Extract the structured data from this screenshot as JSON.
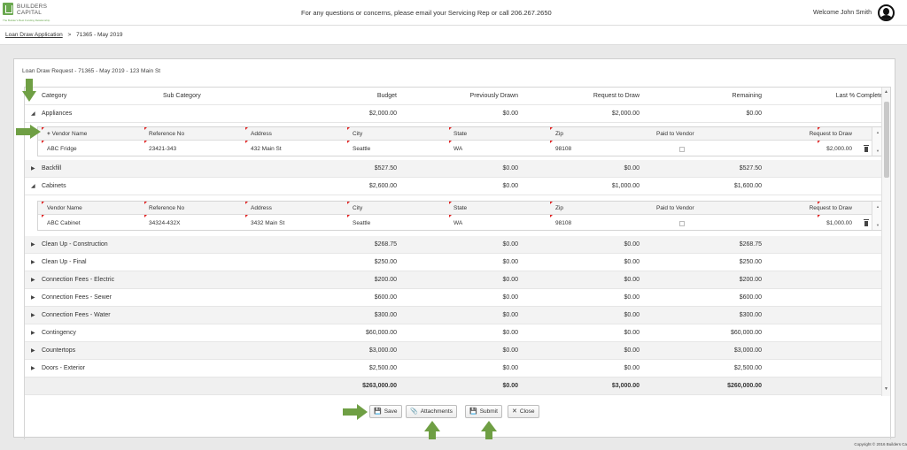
{
  "header": {
    "logo_text_line1": "BUILDERS",
    "logo_text_line2": "CAPITAL",
    "logo_tagline": "The Builder's Best Funding Relationship",
    "contact": "For any questions or concerns, please email your Servicing Rep or call 206.267.2650",
    "welcome": "Welcome John Smith"
  },
  "breadcrumb": {
    "link": "Loan Draw Application",
    "separator": ">",
    "current": "71365 - May 2019"
  },
  "panel": {
    "title": "Loan Draw Request - 71365 - May 2019 - 123 Main St"
  },
  "grid": {
    "columns": [
      "Category",
      "Sub Category",
      "Budget",
      "Previously Drawn",
      "Request to Draw",
      "Remaining",
      "Last % Complete"
    ],
    "rows": [
      {
        "category": "Appliances",
        "budget": "$2,000.00",
        "previous": "$0.00",
        "request": "$2,000.00",
        "remaining": "$0.00",
        "expanded": true
      },
      {
        "category": "Backfill",
        "budget": "$527.50",
        "previous": "$0.00",
        "request": "$0.00",
        "remaining": "$527.50",
        "expanded": false
      },
      {
        "category": "Cabinets",
        "budget": "$2,600.00",
        "previous": "$0.00",
        "request": "$1,000.00",
        "remaining": "$1,600.00",
        "expanded": true
      },
      {
        "category": "Clean Up - Construction",
        "budget": "$268.75",
        "previous": "$0.00",
        "request": "$0.00",
        "remaining": "$268.75",
        "expanded": false
      },
      {
        "category": "Clean Up - Final",
        "budget": "$250.00",
        "previous": "$0.00",
        "request": "$0.00",
        "remaining": "$250.00",
        "expanded": false
      },
      {
        "category": "Connection Fees - Electric",
        "budget": "$200.00",
        "previous": "$0.00",
        "request": "$0.00",
        "remaining": "$200.00",
        "expanded": false
      },
      {
        "category": "Connection Fees - Sewer",
        "budget": "$600.00",
        "previous": "$0.00",
        "request": "$0.00",
        "remaining": "$600.00",
        "expanded": false
      },
      {
        "category": "Connection Fees - Water",
        "budget": "$300.00",
        "previous": "$0.00",
        "request": "$0.00",
        "remaining": "$300.00",
        "expanded": false
      },
      {
        "category": "Contingency",
        "budget": "$60,000.00",
        "previous": "$0.00",
        "request": "$0.00",
        "remaining": "$60,000.00",
        "expanded": false
      },
      {
        "category": "Countertops",
        "budget": "$3,000.00",
        "previous": "$0.00",
        "request": "$0.00",
        "remaining": "$3,000.00",
        "expanded": false
      },
      {
        "category": "Doors - Exterior",
        "budget": "$2,500.00",
        "previous": "$0.00",
        "request": "$0.00",
        "remaining": "$2,500.00",
        "expanded": false
      }
    ],
    "totals": {
      "budget": "$263,000.00",
      "previous": "$0.00",
      "request": "$3,000.00",
      "remaining": "$260,000.00"
    }
  },
  "vendor_grid": {
    "add_symbol": "+",
    "columns": [
      "Vendor Name",
      "Reference No",
      "Address",
      "City",
      "State",
      "Zip",
      "Paid to Vendor",
      "Request to Draw"
    ],
    "appliances": {
      "vendor": "ABC Fridge",
      "reference": "23421-343",
      "address": "432 Main St",
      "city": "Seattle",
      "state": "WA",
      "zip": "98108",
      "request": "$2,000.00"
    },
    "cabinets": {
      "vendor": "ABC Cabinet",
      "reference": "34324-432X",
      "address": "3432 Main St",
      "city": "Seattle",
      "state": "WA",
      "zip": "98108",
      "request": "$1,000.00"
    }
  },
  "buttons": {
    "save": "Save",
    "attachments": "Attachments",
    "submit": "Submit",
    "close": "Close"
  },
  "icons": {
    "save_icon": "floppy-disk-icon",
    "attachments_icon": "paperclip-icon",
    "close_icon": "x-icon",
    "collapse_icon": "triangle-down-icon",
    "expand_icon": "triangle-right-icon",
    "delete_icon": "trash-icon",
    "annotation_arrow": "green-arrow-icon"
  },
  "footer": {
    "copyright": "Copyright © 2016 Builders Ca"
  },
  "colors": {
    "accent_green": "#6aa84f",
    "annotation_green": "#6f9f44",
    "required_marker": "#e02020"
  }
}
